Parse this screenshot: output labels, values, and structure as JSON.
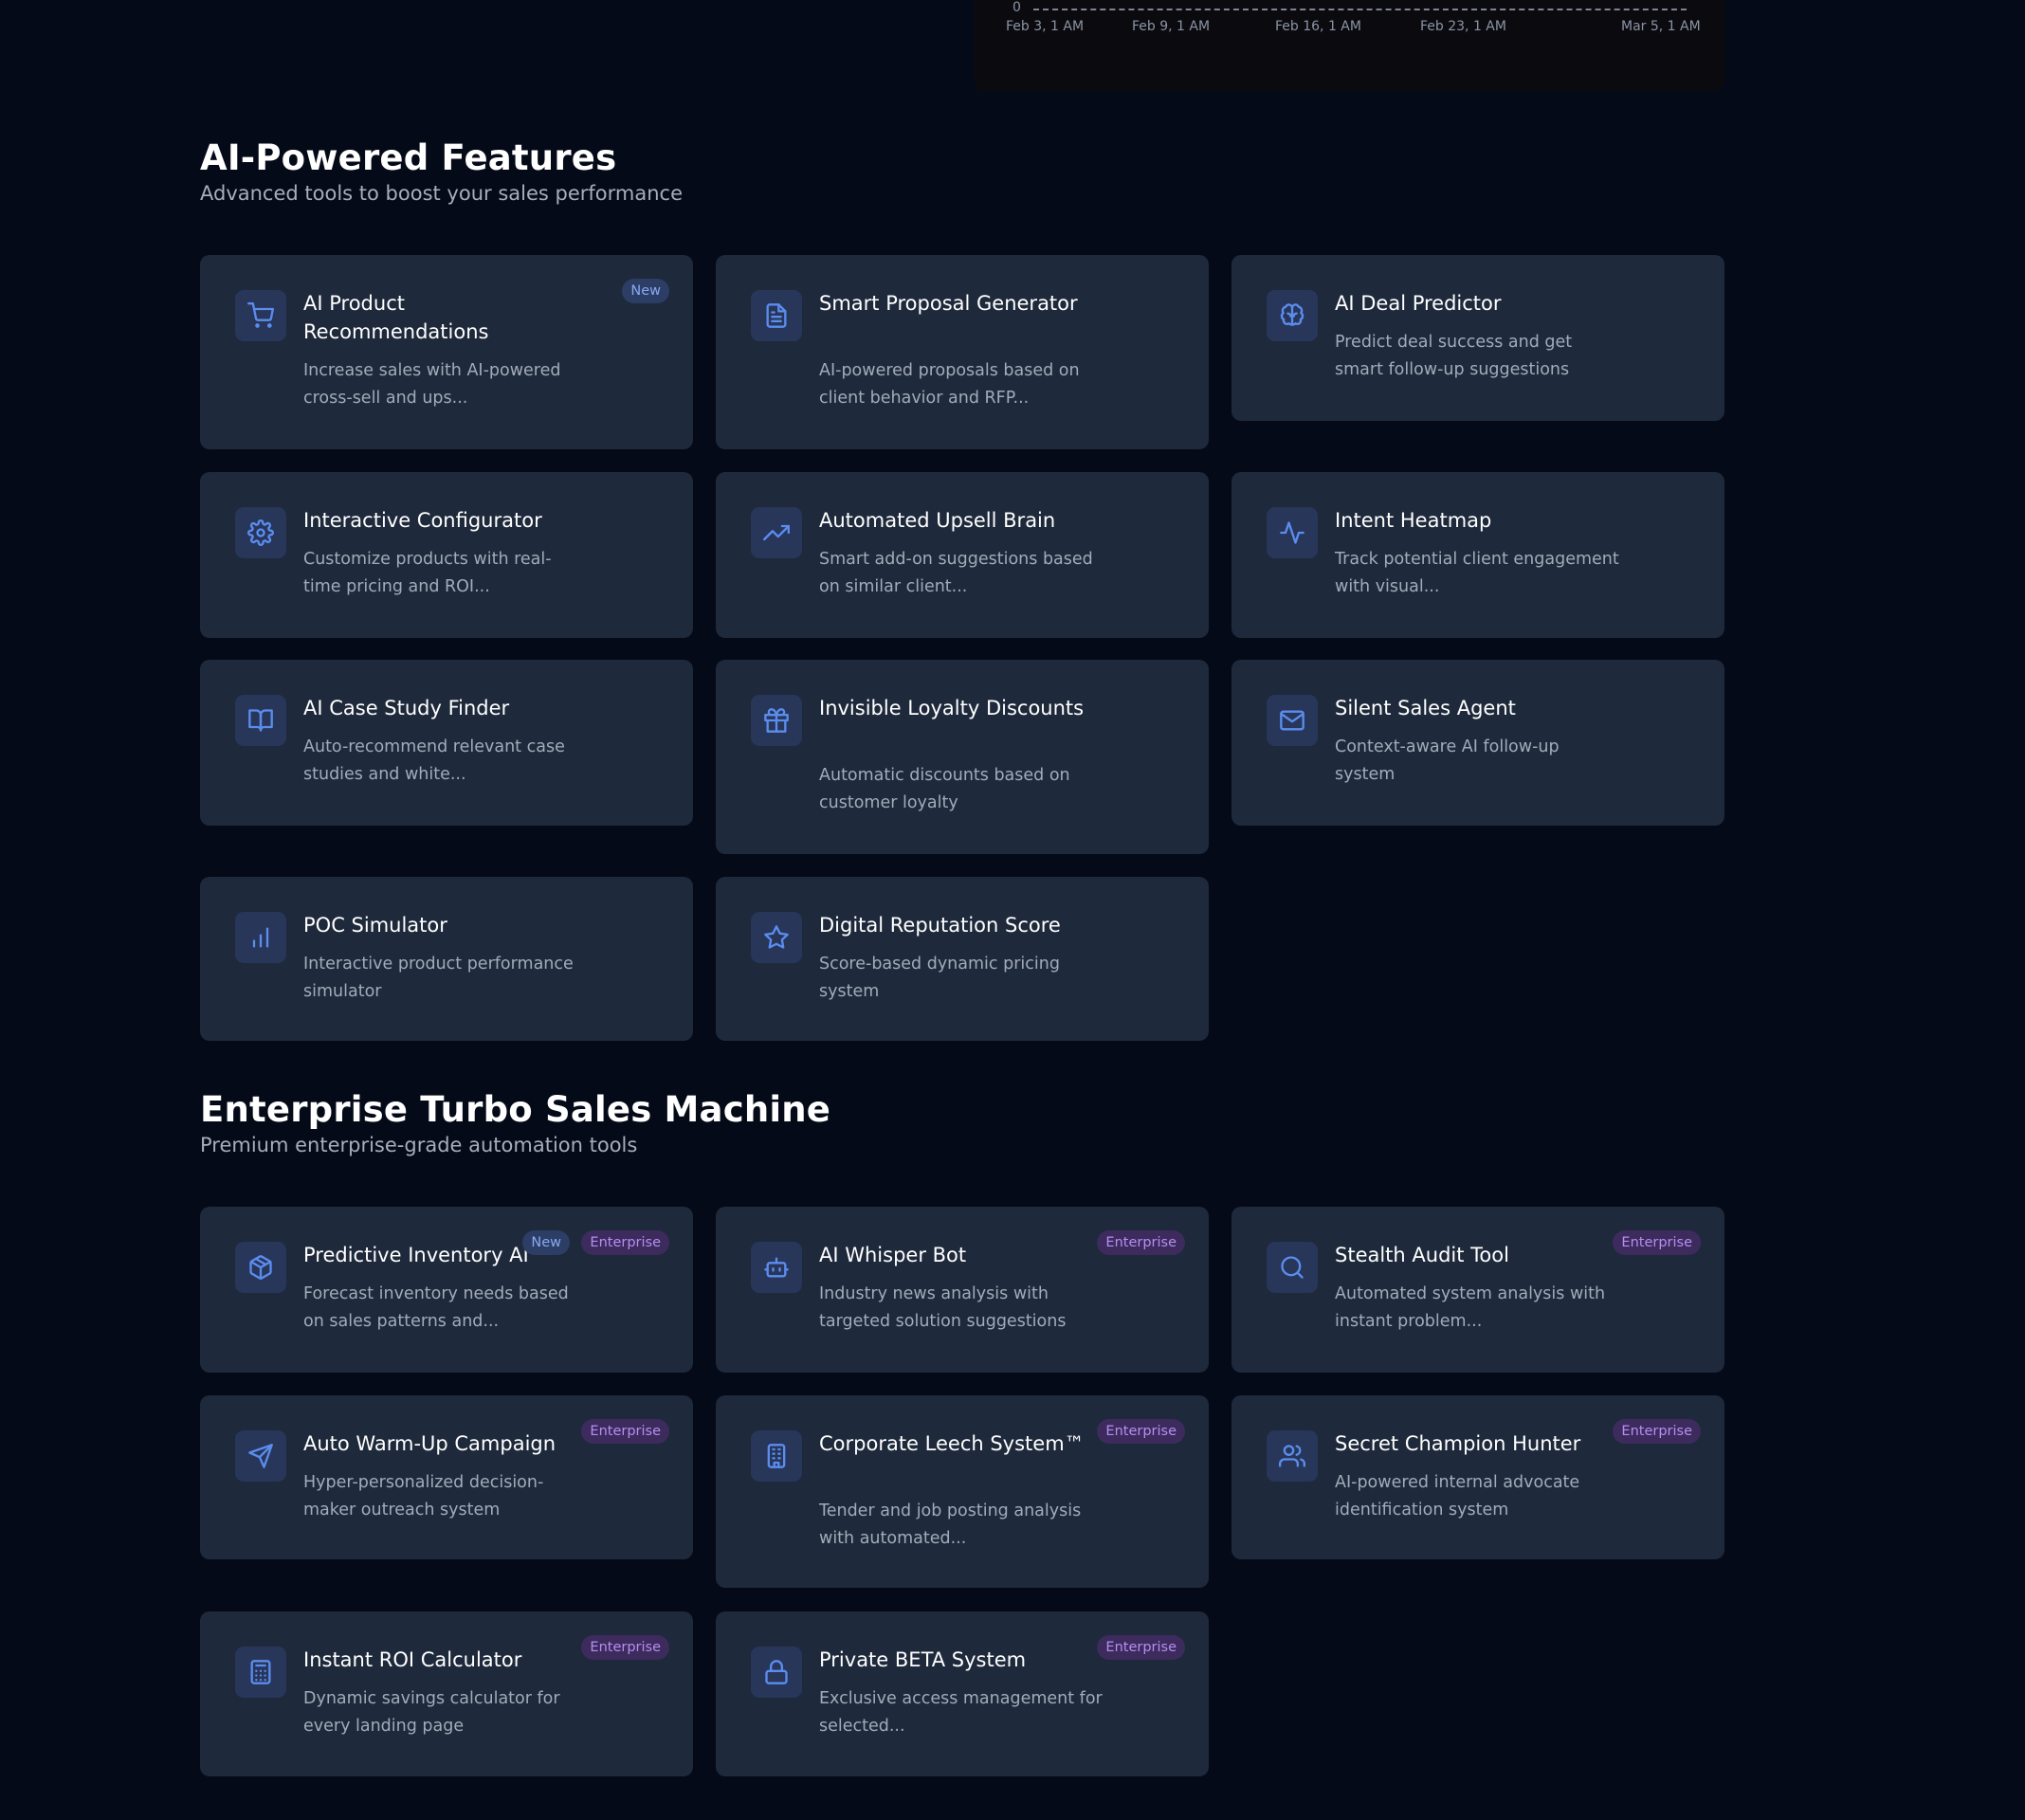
{
  "chart": {
    "y_zero": "0",
    "x_ticks": [
      "Feb 3, 1 AM",
      "Feb 9, 1 AM",
      "Feb 16, 1 AM",
      "Feb 23, 1 AM",
      "Mar 5, 1 AM"
    ]
  },
  "ai_section": {
    "title": "AI-Powered Features",
    "subtitle": "Advanced tools to boost your sales performance",
    "cards": [
      {
        "icon": "shopping-cart-icon",
        "title": "AI Product Recommendations",
        "description": "Increase sales with AI-powered cross-sell and ups...",
        "badge_new": "New"
      },
      {
        "icon": "document-icon",
        "title": "Smart Proposal Generator",
        "description": "AI-powered proposals based on client behavior and RFP..."
      },
      {
        "icon": "brain-icon",
        "title": "AI Deal Predictor",
        "description": "Predict deal success and get smart follow-up suggestions"
      },
      {
        "icon": "gear-icon",
        "title": "Interactive Configurator",
        "description": "Customize products with real-time pricing and ROI..."
      },
      {
        "icon": "trending-up-icon",
        "title": "Automated Upsell Brain",
        "description": "Smart add-on suggestions based on similar client..."
      },
      {
        "icon": "activity-icon",
        "title": "Intent Heatmap",
        "description": "Track potential client engagement with visual..."
      },
      {
        "icon": "book-open-icon",
        "title": "AI Case Study Finder",
        "description": "Auto-recommend relevant case studies and white..."
      },
      {
        "icon": "gift-icon",
        "title": "Invisible Loyalty Discounts",
        "description": "Automatic discounts based on customer loyalty"
      },
      {
        "icon": "mail-icon",
        "title": "Silent Sales Agent",
        "description": "Context-aware AI follow-up system"
      },
      {
        "icon": "bar-chart-icon",
        "title": "POC Simulator",
        "description": "Interactive product performance simulator"
      },
      {
        "icon": "star-icon",
        "title": "Digital Reputation Score",
        "description": "Score-based dynamic pricing system"
      }
    ]
  },
  "enterprise_section": {
    "title": "Enterprise Turbo Sales Machine",
    "subtitle": "Premium enterprise-grade automation tools",
    "cards": [
      {
        "icon": "package-icon",
        "title": "Predictive Inventory AI",
        "description": "Forecast inventory needs based on sales patterns and...",
        "badge_new": "New",
        "badge_enterprise": "Enterprise"
      },
      {
        "icon": "bot-icon",
        "title": "AI Whisper Bot",
        "description": "Industry news analysis with targeted solution suggestions",
        "badge_enterprise": "Enterprise"
      },
      {
        "icon": "search-icon",
        "title": "Stealth Audit Tool",
        "description": "Automated system analysis with instant problem...",
        "badge_enterprise": "Enterprise"
      },
      {
        "icon": "send-icon",
        "title": "Auto Warm-Up Campaign",
        "description": "Hyper-personalized decision-maker outreach system",
        "badge_enterprise": "Enterprise"
      },
      {
        "icon": "building-icon",
        "title": "Corporate Leech System™",
        "description": "Tender and job posting analysis with automated...",
        "badge_enterprise": "Enterprise"
      },
      {
        "icon": "users-icon",
        "title": "Secret Champion Hunter",
        "description": "AI-powered internal advocate identification system",
        "badge_enterprise": "Enterprise"
      },
      {
        "icon": "calculator-icon",
        "title": "Instant ROI Calculator",
        "description": "Dynamic savings calculator for every landing page",
        "badge_enterprise": "Enterprise"
      },
      {
        "icon": "lock-icon",
        "title": "Private BETA System",
        "description": "Exclusive access management for selected...",
        "badge_enterprise": "Enterprise"
      }
    ]
  },
  "colors": {
    "background": "#050a18",
    "card": "#1e293b",
    "accent": "#5b8def",
    "enterprise_badge": "#b58ef0"
  }
}
